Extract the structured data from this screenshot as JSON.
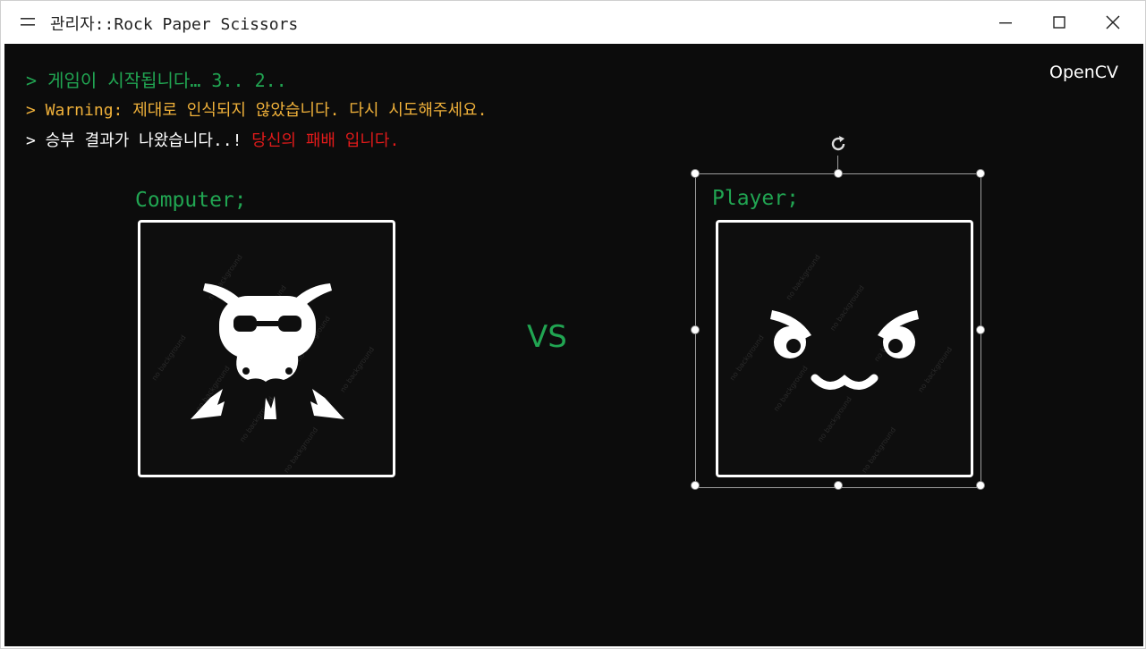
{
  "window": {
    "title": "관리자::Rock Paper Scissors",
    "menu_icon": "menu-icon",
    "controls": [
      "minimize-icon",
      "maximize-icon",
      "close-icon"
    ]
  },
  "console": {
    "line1": "> 게임이 시작됩니다… 3.. 2..",
    "line2": "> Warning: 제대로 인식되지 않았습니다. 다시 시도해주세요.",
    "line3_prefix": "> 승부 결과가 나왔습니다..! ",
    "line3_result": "당신의 패배 입니다.",
    "brand": "OpenCV",
    "colors": {
      "background": "#0c0c0c",
      "info": "#21a552",
      "warning": "#f0b13a",
      "text": "#ffffff",
      "result": "#e21a1a"
    }
  },
  "arena": {
    "computer_label": "Computer;",
    "player_label": "Player;",
    "versus": "VS",
    "computer_icon": "skull-bunny-icon",
    "player_icon": "angry-cat-face-icon",
    "selection_handles": "transform-handles",
    "rotate_icon": "rotate-icon"
  }
}
